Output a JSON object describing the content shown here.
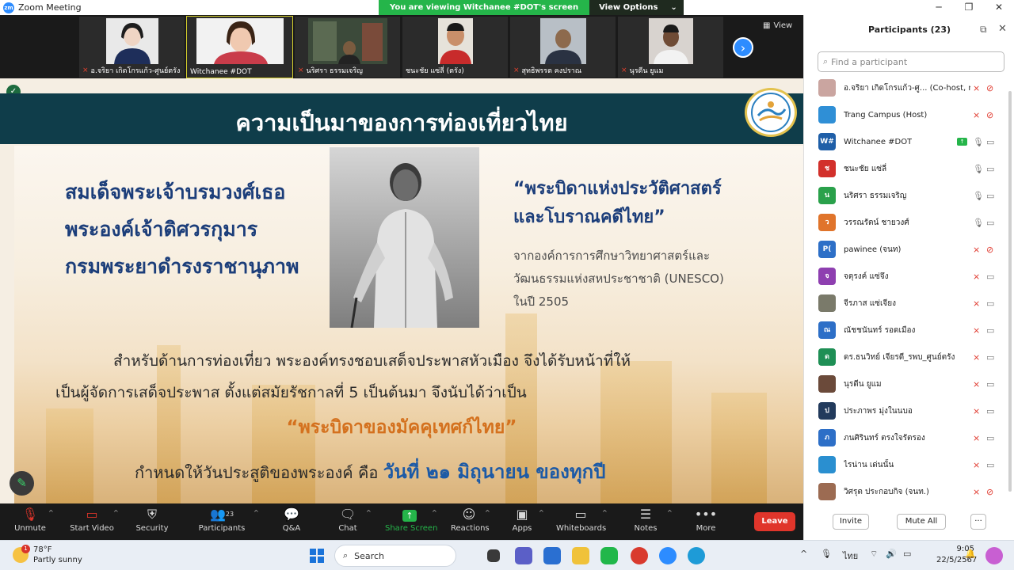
{
  "window": {
    "title": "Zoom Meeting",
    "viewing_banner": "You are viewing Witchanee #DOT's screen",
    "view_options": "View Options"
  },
  "strip": {
    "view_label": "View",
    "thumbnails": [
      {
        "name": "อ.จริยา เกิดโกรแก้ว-ศูนย์ตรัง",
        "muted": true,
        "face": "#efd5c4",
        "bg": "#e9e9e9"
      },
      {
        "name": "Witchanee #DOT",
        "muted": false,
        "face": "#f0c9b0",
        "bg": "#f2f2f2"
      },
      {
        "name": "นริศรา ธรรมเจริญ",
        "muted": true,
        "face": "#7a5b3f",
        "bg": "#3c4a3a"
      },
      {
        "name": "ชนะชัย แซ่ลี่ (ตรัง)",
        "muted": false,
        "face": "#c98f6a",
        "bg": "#e6e2da"
      },
      {
        "name": "สุทธิพรรต คงปราณ",
        "muted": true,
        "face": "#8d6a4d",
        "bg": "#b8bfc6"
      },
      {
        "name": "นุรดีน ยูแม",
        "muted": true,
        "face": "#6f4b35",
        "bg": "#d8d3cf"
      }
    ]
  },
  "slide": {
    "title": "ความเป็นมาของการท่องเที่ยวไทย",
    "left_name": [
      "สมเด็จพระเจ้าบรมวงศ์เธอ",
      "พระองค์เจ้าดิศวรกุมาร",
      "กรมพระยาดำรงราชานุภาพ"
    ],
    "quote": [
      "“พระบิดาแห่งประวัติศาสตร์",
      "และโบราณคดีไทย”"
    ],
    "unesco": [
      "จากองค์การการศึกษาวิทยาศาสตร์และ",
      "วัฒนธรรมแห่งสหประชาชาติ (UNESCO)",
      "ในปี 2505"
    ],
    "paragraph": [
      "สำหรับด้านการท่องเที่ยว พระองค์ทรงชอบเสด็จประพาสหัวเมือง จึงได้รับหน้าที่ให้",
      "เป็นผู้จัดการเสด็จประพาส ตั้งแต่สมัยรัชกาลที่ 5 เป็นต้นมา จึงนับได้ว่าเป็น"
    ],
    "highlight": "“พระบิดาของมัคคุเทศก์ไทย”",
    "birthday_prefix": "กำหนดให้วันประสูติของพระองค์ คือ",
    "birthday_date": "วันที่ ๒๑ มิถุนายน ของทุกปี"
  },
  "toolbar": {
    "unmute": "Unmute",
    "start_video": "Start Video",
    "security": "Security",
    "participants": "Participants",
    "participants_count": "23",
    "qa": "Q&A",
    "chat": "Chat",
    "share_screen": "Share Screen",
    "reactions": "Reactions",
    "apps": "Apps",
    "whiteboards": "Whiteboards",
    "notes": "Notes",
    "more": "More",
    "leave": "Leave"
  },
  "panel": {
    "title": "Participants (23)",
    "search_placeholder": "Find a participant",
    "invite": "Invite",
    "mute_all": "Mute All",
    "more": "···",
    "participants": [
      {
        "name": "อ.จริยา เกิดโกรแก้ว-ศู... (Co-host, me)",
        "initial": "",
        "color": "#caa5a0",
        "mic": "muted",
        "cam": "off"
      },
      {
        "name": "Trang Campus (Host)",
        "initial": "",
        "color": "#2f8fd6",
        "mic": "muted",
        "cam": "off"
      },
      {
        "name": "Witchanee #DOT",
        "initial": "W#",
        "color": "#1f5fa8",
        "mic": "on",
        "cam": "on",
        "sharing": true
      },
      {
        "name": "ชนะชัย แซ่ลี่",
        "initial": "ช",
        "color": "#d2302b",
        "mic": "on",
        "cam": "on"
      },
      {
        "name": "นริศรา ธรรมเจริญ",
        "initial": "น",
        "color": "#2aa14b",
        "mic": "on",
        "cam": "on"
      },
      {
        "name": "วรรณรัตน์ ชายวงศ์",
        "initial": "ว",
        "color": "#e0742b",
        "mic": "on",
        "cam": "on"
      },
      {
        "name": "pawinee (จนท)",
        "initial": "P(",
        "color": "#2d6fc7",
        "mic": "muted",
        "cam": "off"
      },
      {
        "name": "จตุรงค์ แซ่จึง",
        "initial": "จ",
        "color": "#8e3fb0",
        "mic": "muted",
        "cam": "on"
      },
      {
        "name": "จีรภาส แซ่เจียง",
        "initial": "",
        "color": "#7a7a6a",
        "mic": "muted",
        "cam": "on"
      },
      {
        "name": "ณัชชนันทร์ รอดเมือง",
        "initial": "ณ",
        "color": "#2d6fc7",
        "mic": "muted",
        "cam": "on"
      },
      {
        "name": "ดร.ธนวิทย์ เจียรดี_รพบ_ศูนย์ตรัง",
        "initial": "ด",
        "color": "#1e8f55",
        "mic": "muted",
        "cam": "on"
      },
      {
        "name": "นุรดีน ยูแม",
        "initial": "",
        "color": "#6b4a3a",
        "mic": "muted",
        "cam": "on"
      },
      {
        "name": "ประภาพร มุ่งในนบอ",
        "initial": "ป",
        "color": "#223a5c",
        "mic": "muted",
        "cam": "on"
      },
      {
        "name": "ภนศิรินทร์ ตรงใจรัตรอง",
        "initial": "ภ",
        "color": "#2d6fc7",
        "mic": "muted",
        "cam": "on"
      },
      {
        "name": "ไรน่าน เด่นนั้น",
        "initial": "",
        "color": "#2a8fd0",
        "mic": "muted",
        "cam": "on"
      },
      {
        "name": "วิศรุต ประกอบกิจ (จนท.)",
        "initial": "",
        "color": "#9c6b52",
        "mic": "muted",
        "cam": "off"
      }
    ]
  },
  "taskbar": {
    "temperature": "78°F",
    "weather": "Partly sunny",
    "weather_badge": "1",
    "search": "Search",
    "lang": "ไทย",
    "time": "9:05",
    "date": "22/5/2567"
  }
}
